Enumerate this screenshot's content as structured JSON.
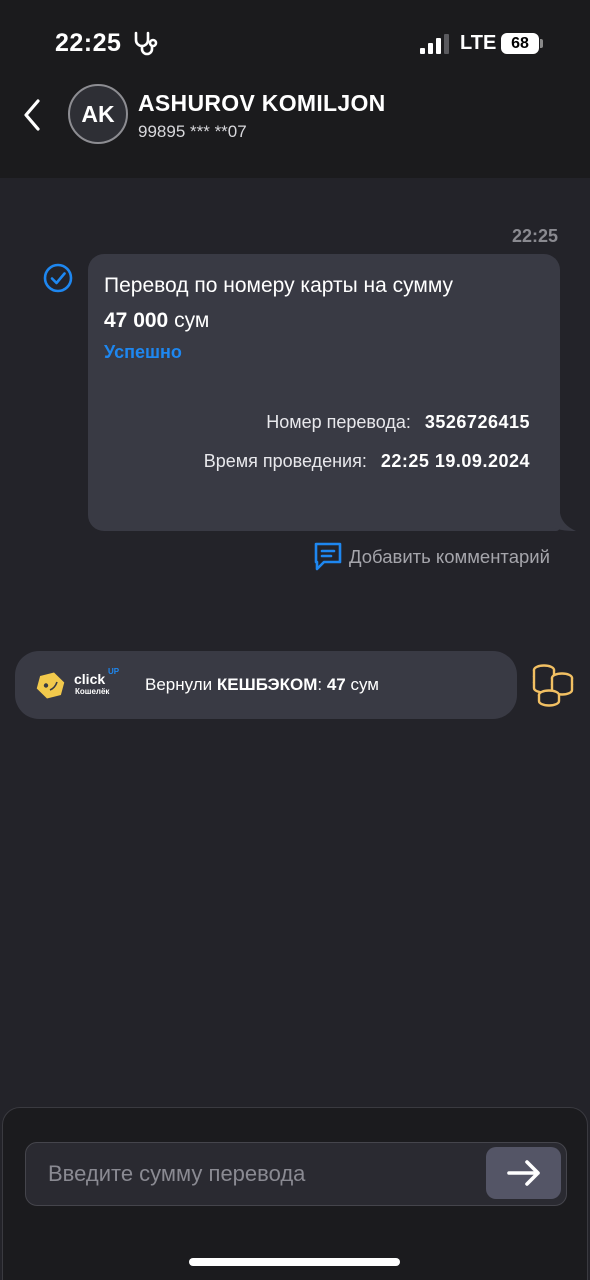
{
  "status_bar": {
    "time": "22:25",
    "network": "LTE",
    "battery": "68",
    "health_icon": "stethoscope-icon",
    "signal_icon": "signal-bars-icon"
  },
  "header": {
    "back_icon": "chevron-left-icon",
    "avatar_initials": "AK",
    "name": "ASHUROV KOMILJON",
    "phone": "99895 *** **07"
  },
  "message": {
    "time": "22:25",
    "status_icon": "check-circle-icon",
    "title": "Перевод по номеру карты на сумму",
    "amount": "47 000",
    "currency": "сум",
    "status": "Успешно",
    "transfer_number_label": "Номер перевода:",
    "transfer_number": "3526726415",
    "time_label": "Время проведения:",
    "time_value": "22:25 19.09.2024"
  },
  "add_comment": {
    "icon": "comment-icon",
    "label": "Добавить комментарий"
  },
  "cashback": {
    "logo_icon": "click-wallet-icon",
    "brand": "click",
    "brand_superscript": "UP",
    "brand_sub": "Кошелёк",
    "text_prefix": "Вернули ",
    "text_bold": "КЕШБЭКОМ",
    "text_colon": ": ",
    "amount": "47",
    "currency": " сум",
    "coins_icon": "coins-icon"
  },
  "input": {
    "placeholder": "Введите сумму перевода",
    "send_icon": "arrow-right-icon"
  },
  "colors": {
    "background": "#232329",
    "bar": "#1b1b1d",
    "bubble": "#393a44",
    "accent": "#1e87f0",
    "coins": "#f2c063"
  }
}
